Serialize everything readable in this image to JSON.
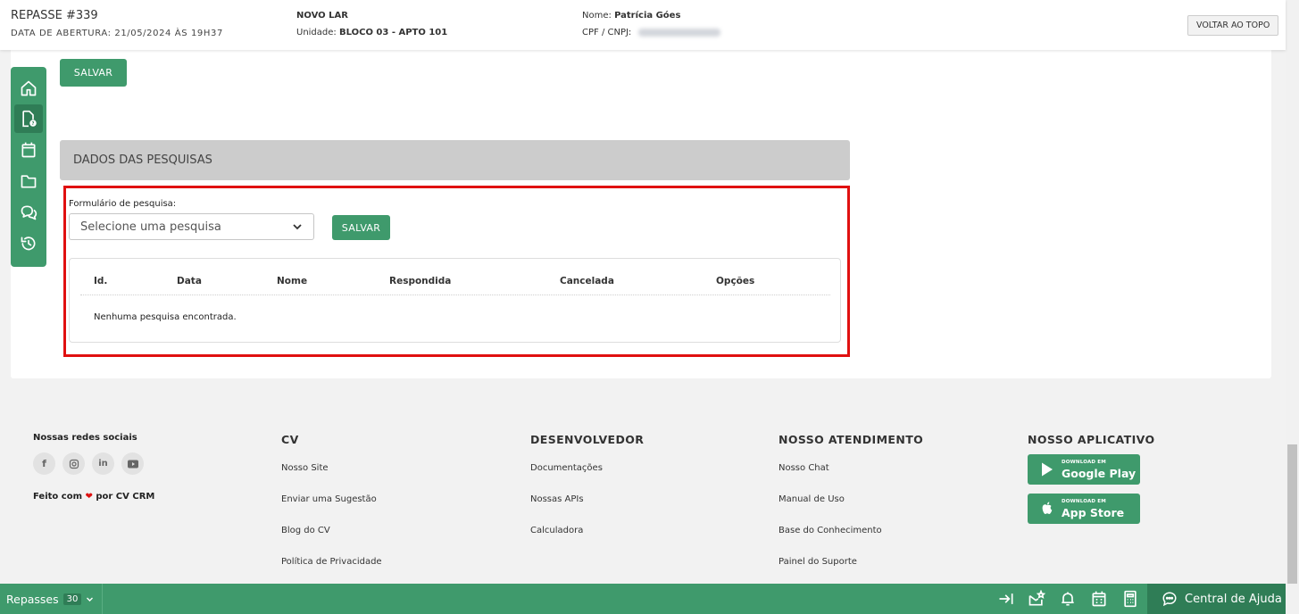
{
  "header": {
    "title": "REPASSE #339",
    "opening_date": "DATA DE ABERTURA: 21/05/2024 ÀS 19H37",
    "project": "NOVO LAR",
    "unit_label": "Unidade:",
    "unit_value": "BLOCO 03 - APTO 101",
    "name_label": "Nome:",
    "name_value": "Patrícia Góes",
    "doc_label": "CPF / CNPJ:",
    "back_top": "VOLTAR AO TOPO"
  },
  "sidebar": {
    "items": [
      {
        "icon": "home-icon"
      },
      {
        "icon": "document-question-icon",
        "active": true
      },
      {
        "icon": "calendar-icon"
      },
      {
        "icon": "folder-icon"
      },
      {
        "icon": "chat-icon"
      },
      {
        "icon": "history-icon"
      }
    ]
  },
  "main": {
    "save_top": "SALVAR",
    "section_title": "DADOS DAS PESQUISAS",
    "form_label": "Formulário de pesquisa:",
    "select_value": "Selecione uma pesquisa",
    "save_form": "SALVAR",
    "table": {
      "headers": [
        "Id.",
        "Data",
        "Nome",
        "Respondida",
        "Cancelada",
        "Opções"
      ],
      "empty_text": "Nenhuma pesquisa encontrada."
    }
  },
  "footer": {
    "social_title": "Nossas redes sociais",
    "social_icons": [
      "facebook-icon",
      "instagram-icon",
      "linkedin-icon",
      "youtube-icon"
    ],
    "made_with_prefix": "Feito com",
    "made_with_suffix": "por CV CRM",
    "columns": [
      {
        "title": "CV",
        "links": [
          "Nosso Site",
          "Enviar uma Sugestão",
          "Blog do CV",
          "Política de Privacidade"
        ]
      },
      {
        "title": "DESENVOLVEDOR",
        "links": [
          "Documentações",
          "Nossas APIs",
          "Calculadora"
        ]
      },
      {
        "title": "NOSSO ATENDIMENTO",
        "links": [
          "Nosso Chat",
          "Manual de Uso",
          "Base do Conhecimento",
          "Painel do Suporte"
        ]
      },
      {
        "title": "NOSSO APLICATIVO"
      }
    ],
    "stores": [
      {
        "small": "DOWNLOAD EM",
        "big": "Google Play"
      },
      {
        "small": "DOWNLOAD EM",
        "big": "App Store"
      }
    ]
  },
  "bottombar": {
    "module": "Repasses",
    "count": "30",
    "help": "Central de Ajuda"
  },
  "colors": {
    "accent": "#3f9a6c",
    "accent_dark": "#2f7d56",
    "highlight_border": "#e01010"
  }
}
